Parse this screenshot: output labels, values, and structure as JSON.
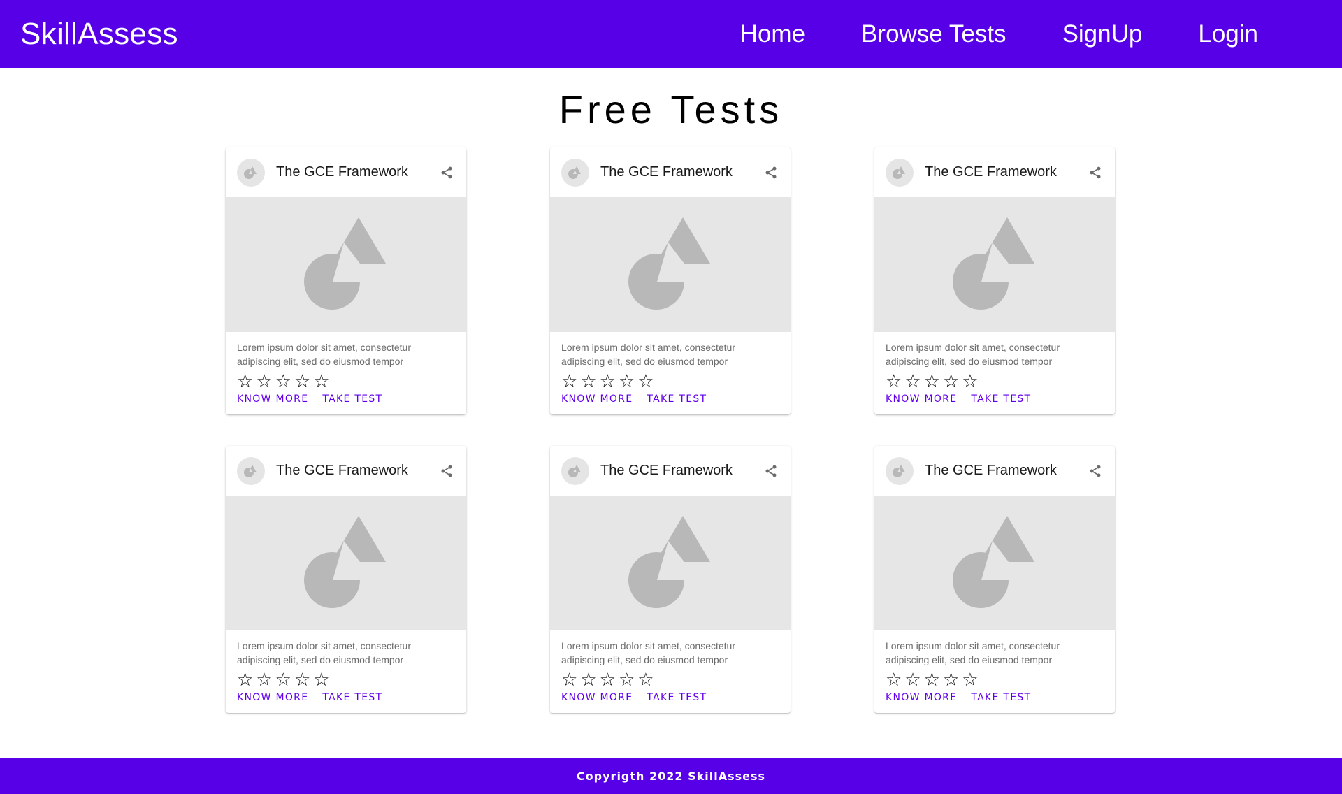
{
  "header": {
    "brand": "SkillAssess",
    "nav": [
      {
        "label": "Home"
      },
      {
        "label": "Browse Tests"
      },
      {
        "label": "SignUp"
      },
      {
        "label": "Login"
      }
    ]
  },
  "main": {
    "title": "Free Tests",
    "cards": [
      {
        "title": "The GCE Framework",
        "description": "Lorem ipsum dolor sit amet, consectetur adipiscing elit, sed do eiusmod tempor",
        "rating": 0,
        "max_rating": 5,
        "know_more": "KNOW MORE",
        "take_test": "TAKE TEST"
      },
      {
        "title": "The GCE Framework",
        "description": "Lorem ipsum dolor sit amet, consectetur adipiscing elit, sed do eiusmod tempor",
        "rating": 0,
        "max_rating": 5,
        "know_more": "KNOW MORE",
        "take_test": "TAKE TEST"
      },
      {
        "title": "The GCE Framework",
        "description": "Lorem ipsum dolor sit amet, consectetur adipiscing elit, sed do eiusmod tempor",
        "rating": 0,
        "max_rating": 5,
        "know_more": "KNOW MORE",
        "take_test": "TAKE TEST"
      },
      {
        "title": "The GCE Framework",
        "description": "Lorem ipsum dolor sit amet, consectetur adipiscing elit, sed do eiusmod tempor",
        "rating": 0,
        "max_rating": 5,
        "know_more": "KNOW MORE",
        "take_test": "TAKE TEST"
      },
      {
        "title": "The GCE Framework",
        "description": "Lorem ipsum dolor sit amet, consectetur adipiscing elit, sed do eiusmod tempor",
        "rating": 0,
        "max_rating": 5,
        "know_more": "KNOW MORE",
        "take_test": "TAKE TEST"
      },
      {
        "title": "The GCE Framework",
        "description": "Lorem ipsum dolor sit amet, consectetur adipiscing elit, sed do eiusmod tempor",
        "rating": 0,
        "max_rating": 5,
        "know_more": "KNOW MORE",
        "take_test": "TAKE TEST"
      }
    ]
  },
  "footer": {
    "text": "Copyrigth 2022 SkillAssess"
  },
  "icons": {
    "avatar": "placeholder-shapes-icon",
    "share": "share-icon",
    "media": "placeholder-shapes-icon",
    "star": "star-outline-icon"
  },
  "colors": {
    "primary": "#5700e8",
    "accent": "#6200ee",
    "media_bg": "#e6e6e6",
    "placeholder_shape": "#b8b8b8"
  }
}
